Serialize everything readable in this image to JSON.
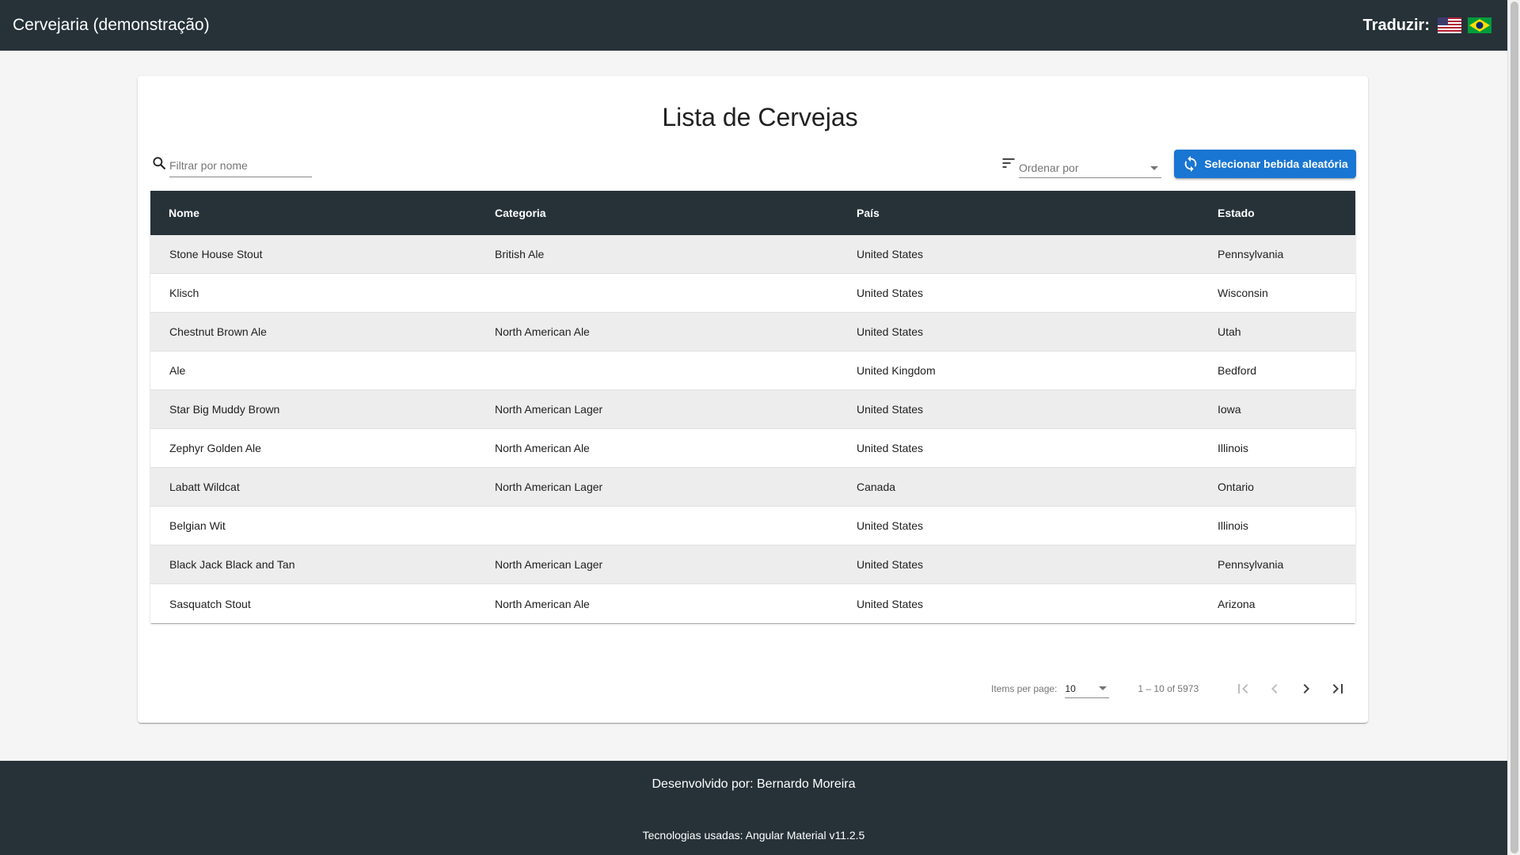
{
  "header": {
    "title": "Cervejaria (demonstração)",
    "translate_label": "Traduzir:",
    "flags": [
      "us-flag-icon",
      "brazil-flag-icon"
    ]
  },
  "main": {
    "title": "Lista de Cervejas",
    "filter": {
      "placeholder": "Filtrar por nome",
      "value": ""
    },
    "sort": {
      "placeholder": "Ordenar por"
    },
    "random_button": "Selecionar bebida aleatória"
  },
  "table": {
    "headers": [
      "Nome",
      "Categoria",
      "País",
      "Estado"
    ],
    "rows": [
      [
        "Stone House Stout",
        "British Ale",
        "United States",
        "Pennsylvania"
      ],
      [
        "Klisch",
        "",
        "United States",
        "Wisconsin"
      ],
      [
        "Chestnut Brown Ale",
        "North American Ale",
        "United States",
        "Utah"
      ],
      [
        "Ale",
        "",
        "United Kingdom",
        "Bedford"
      ],
      [
        "Star Big Muddy Brown",
        "North American Lager",
        "United States",
        "Iowa"
      ],
      [
        "Zephyr Golden Ale",
        "North American Ale",
        "United States",
        "Illinois"
      ],
      [
        "Labatt Wildcat",
        "North American Lager",
        "Canada",
        "Ontario"
      ],
      [
        "Belgian Wit",
        "",
        "United States",
        "Illinois"
      ],
      [
        "Black Jack Black and Tan",
        "North American Lager",
        "United States",
        "Pennsylvania"
      ],
      [
        "Sasquatch Stout",
        "North American Ale",
        "United States",
        "Arizona"
      ]
    ]
  },
  "paginator": {
    "items_per_page_label": "Items per page:",
    "items_per_page": "10",
    "range": "1 – 10 of 5973"
  },
  "footer": {
    "developer": "Desenvolvido por: Bernardo Moreira",
    "technologies": "Tecnologias usadas: Angular Material v11.2.5"
  },
  "colors": {
    "toolbar": "#263238",
    "primary_button": "#1976d2",
    "row_alt": "#ededed"
  }
}
